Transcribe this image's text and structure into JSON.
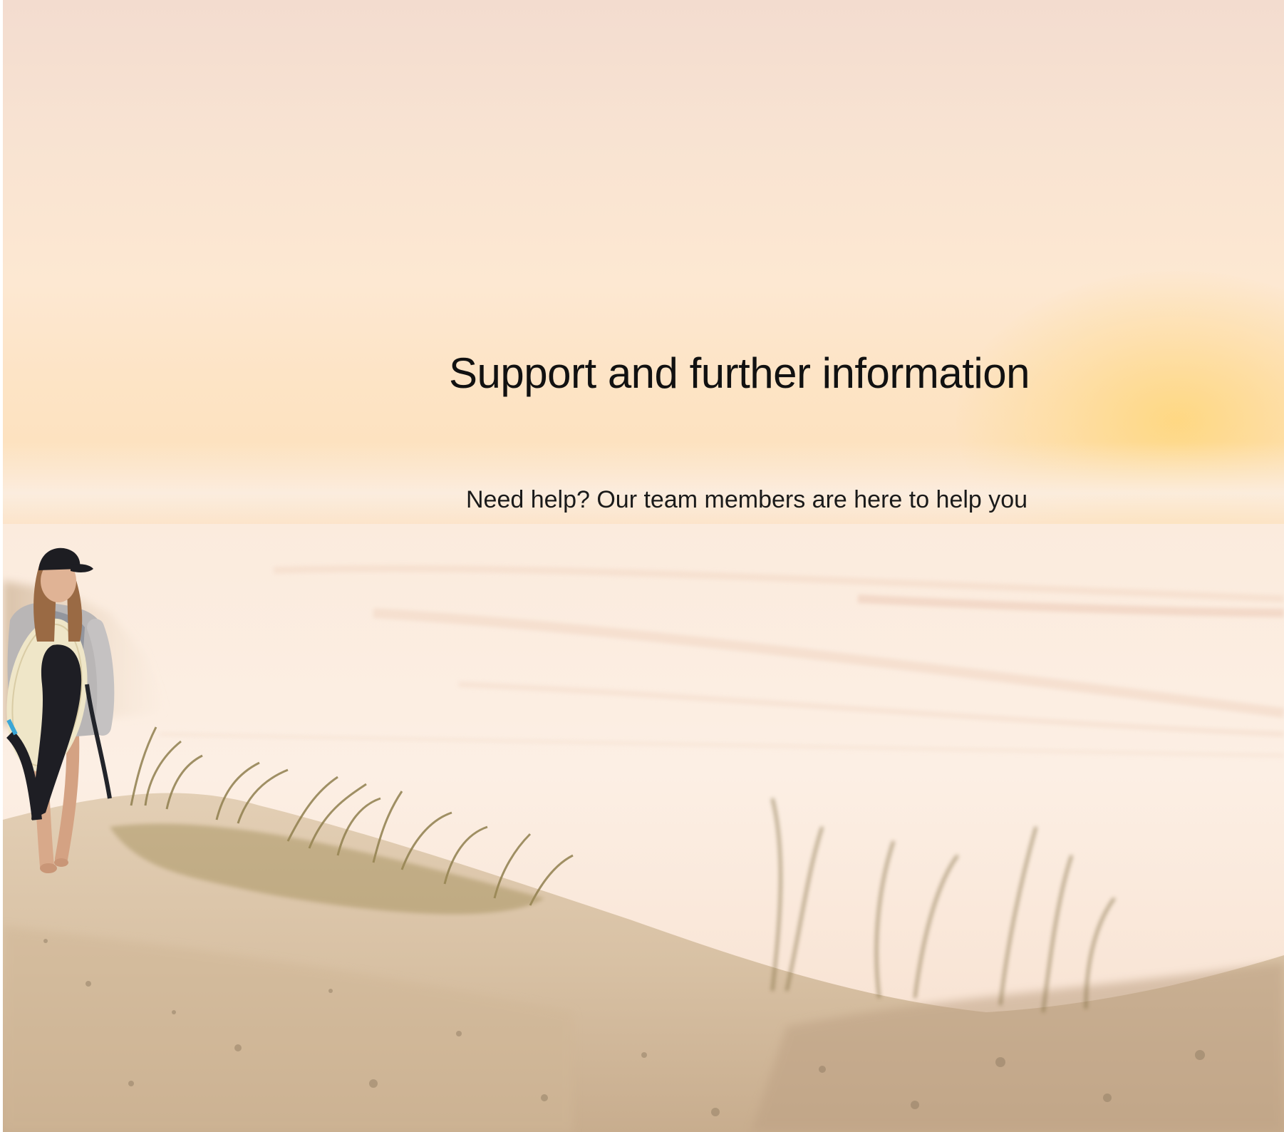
{
  "hero": {
    "title": "Support and further information",
    "subtitle": "Need help? Our team members are here to help you",
    "background": "beach-sunset-surfer-photo"
  },
  "colors": {
    "sky_top": "#f3dccf",
    "sky_glow": "#fcdcb6",
    "sun": "#ffd678",
    "sea": "#fbeee2",
    "sand": "#d8c3a8",
    "grass": "#9c8a55",
    "text": "#111111"
  }
}
